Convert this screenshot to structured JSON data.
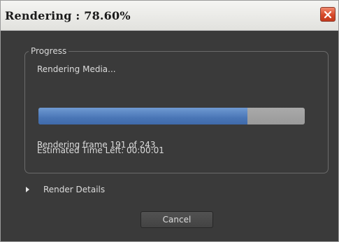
{
  "window": {
    "title": "Rendering : 78.60%"
  },
  "progress_group": {
    "legend": "Progress",
    "status": "Rendering Media...",
    "progress_fraction": 0.786,
    "frame_text": "Rendering frame 191 of 243",
    "time_left_text": "Estimated Time Left: 00:00:01"
  },
  "details": {
    "label": "Render Details"
  },
  "buttons": {
    "cancel_label": "Cancel"
  },
  "colors": {
    "progress_fill": "#4a76b6",
    "progress_track": "#a0a0a0",
    "close_button": "#d6492a"
  },
  "icons": {
    "close": "close-x-icon",
    "expand": "triangle-right-icon"
  }
}
